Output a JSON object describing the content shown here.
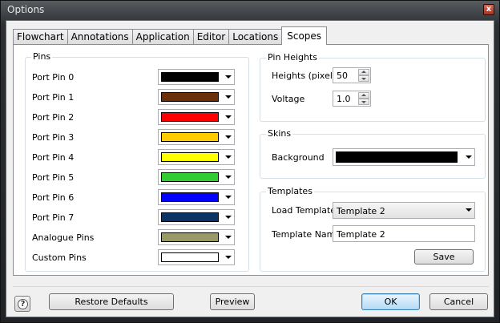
{
  "window": {
    "title": "Options",
    "close_glyph": "x"
  },
  "tabs": [
    "Flowchart",
    "Annotations",
    "Application",
    "Editor",
    "Locations",
    "Scopes"
  ],
  "active_tab": "Scopes",
  "pins": {
    "title": "Pins",
    "items": [
      {
        "label": "Port Pin 0",
        "color": "#000000"
      },
      {
        "label": "Port Pin 1",
        "color": "#6b2f0a"
      },
      {
        "label": "Port Pin 2",
        "color": "#ff0000"
      },
      {
        "label": "Port Pin 3",
        "color": "#ffcc00"
      },
      {
        "label": "Port Pin 4",
        "color": "#ffff00"
      },
      {
        "label": "Port Pin 5",
        "color": "#33cc33"
      },
      {
        "label": "Port Pin 6",
        "color": "#0000ff"
      },
      {
        "label": "Port Pin 7",
        "color": "#0a3366"
      },
      {
        "label": "Analogue Pins",
        "color": "#999966"
      },
      {
        "label": "Custom Pins",
        "color": "#ffffff"
      }
    ]
  },
  "pin_heights": {
    "title": "Pin Heights",
    "heights_label": "Heights (pixels)",
    "heights_value": "50",
    "voltage_label": "Voltage",
    "voltage_value": "1.0"
  },
  "skins": {
    "title": "Skins",
    "background_label": "Background",
    "background_color": "#000000"
  },
  "templates": {
    "title": "Templates",
    "load_label": "Load Template",
    "load_value": "Template 2",
    "name_label": "Template Name",
    "name_value": "Template 2",
    "save_label": "Save"
  },
  "footer": {
    "help_glyph": "?",
    "restore_label": "Restore Defaults",
    "preview_label": "Preview",
    "ok_label": "OK",
    "cancel_label": "Cancel"
  }
}
